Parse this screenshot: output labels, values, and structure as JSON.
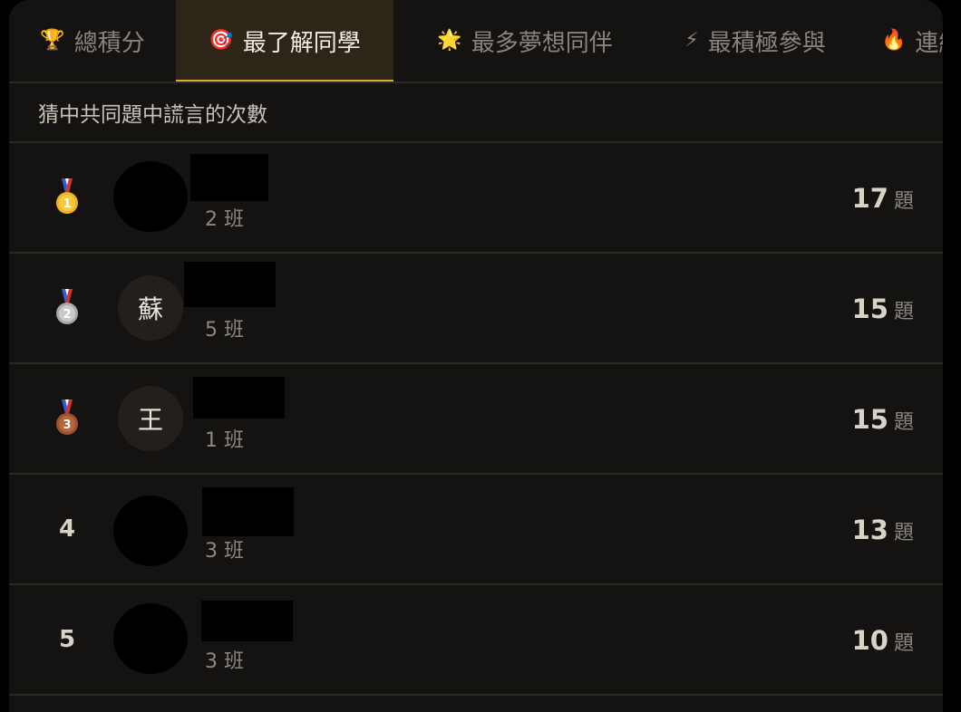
{
  "tabs": [
    {
      "icon": "🏆",
      "icon_name": "trophy-icon",
      "label": "總積分",
      "active": false
    },
    {
      "icon": "🎯",
      "icon_name": "target-icon",
      "label": "最了解同學",
      "active": true
    },
    {
      "icon": "🌟",
      "icon_name": "star-icon",
      "label": "最多夢想同伴",
      "active": false
    },
    {
      "icon": "⚡",
      "icon_name": "lightning-icon",
      "label": "最積極參與",
      "active": false
    },
    {
      "icon": "🔥",
      "icon_name": "fire-icon",
      "label": "連續",
      "active": false
    }
  ],
  "subtitle": "猜中共同題中謊言的次數",
  "score_unit": "題",
  "rows": [
    {
      "rank": "1",
      "medal": "gold-medal-icon",
      "avatar_text": "",
      "class_label": "2 班",
      "score": "17"
    },
    {
      "rank": "2",
      "medal": "silver-medal-icon",
      "avatar_text": "蘇",
      "class_label": "5 班",
      "score": "15"
    },
    {
      "rank": "3",
      "medal": "bronze-medal-icon",
      "avatar_text": "王",
      "class_label": "1 班",
      "score": "15"
    },
    {
      "rank": "4",
      "medal": "",
      "avatar_text": "",
      "class_label": "3 班",
      "score": "13"
    },
    {
      "rank": "5",
      "medal": "",
      "avatar_text": "",
      "class_label": "3 班",
      "score": "10"
    }
  ],
  "colors": {
    "background": "#141312",
    "active_tab_bg": "#2d2618",
    "active_tab_underline": "#e2a93a",
    "gold": "#f2b320",
    "silver": "#c9c9c9",
    "bronze": "#b5663a"
  }
}
